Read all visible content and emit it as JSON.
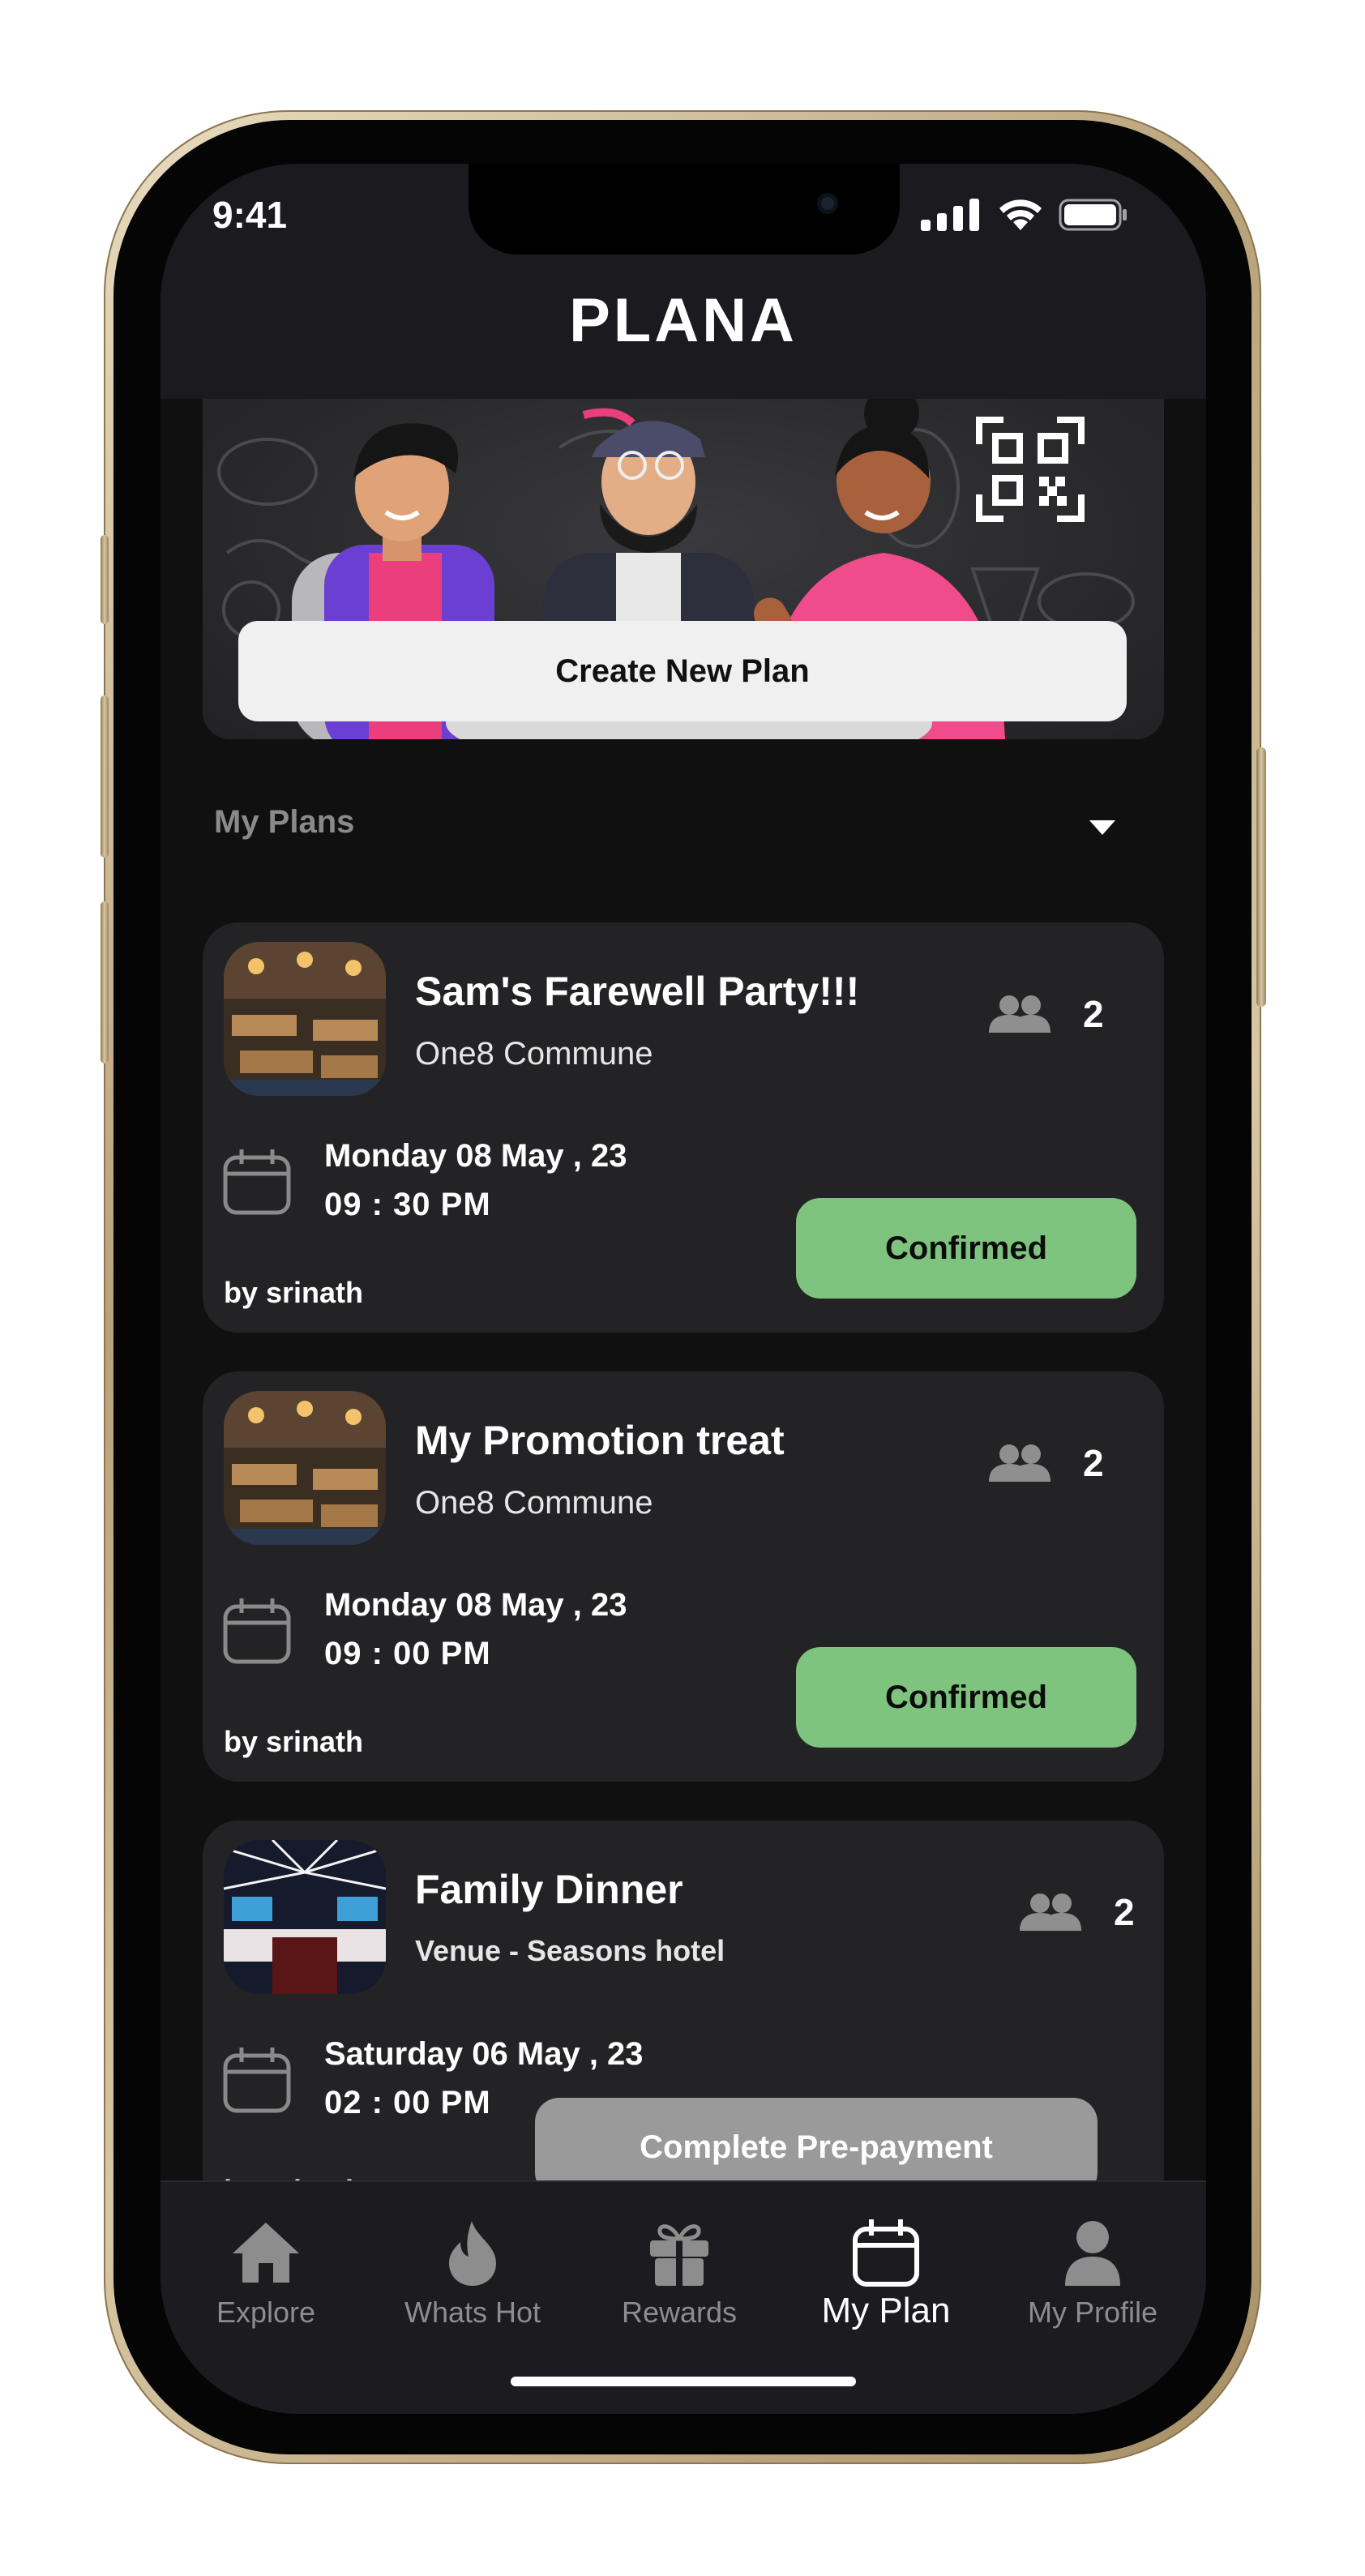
{
  "status_bar": {
    "time": "9:41"
  },
  "header": {
    "logo": "PLANA"
  },
  "hero": {
    "create_button": "Create New Plan"
  },
  "section": {
    "title": "My Plans"
  },
  "plans": [
    {
      "title": "Sam's Farewell Party!!!",
      "venue": "One8 Commune",
      "people": "2",
      "date": "Monday 08 May , 23",
      "time": "09 : 30  PM",
      "by": "by srinath",
      "action": "Confirmed"
    },
    {
      "title": "My Promotion treat",
      "venue": "One8 Commune",
      "people": "2",
      "date": "Monday 08 May , 23",
      "time": "09 : 00  PM",
      "by": "by srinath",
      "action": "Confirmed"
    },
    {
      "title": "Family Dinner",
      "venue": "Venue - Seasons hotel",
      "people": "2",
      "date": "Saturday 06 May , 23",
      "time": "02 : 00  PM",
      "by": "by srinath",
      "action": "Complete Pre-payment"
    }
  ],
  "nav": {
    "items": [
      {
        "label": "Explore",
        "icon": "home-icon"
      },
      {
        "label": "Whats Hot",
        "icon": "flame-icon"
      },
      {
        "label": "Rewards",
        "icon": "gift-icon"
      },
      {
        "label": "My Plan",
        "icon": "calendar-icon",
        "active": true
      },
      {
        "label": "My Profile",
        "icon": "person-icon"
      }
    ]
  },
  "colors": {
    "confirmed": "#7ec47f",
    "prepayment": "#9a9a9a",
    "background": "#101010",
    "card": "#232326"
  }
}
